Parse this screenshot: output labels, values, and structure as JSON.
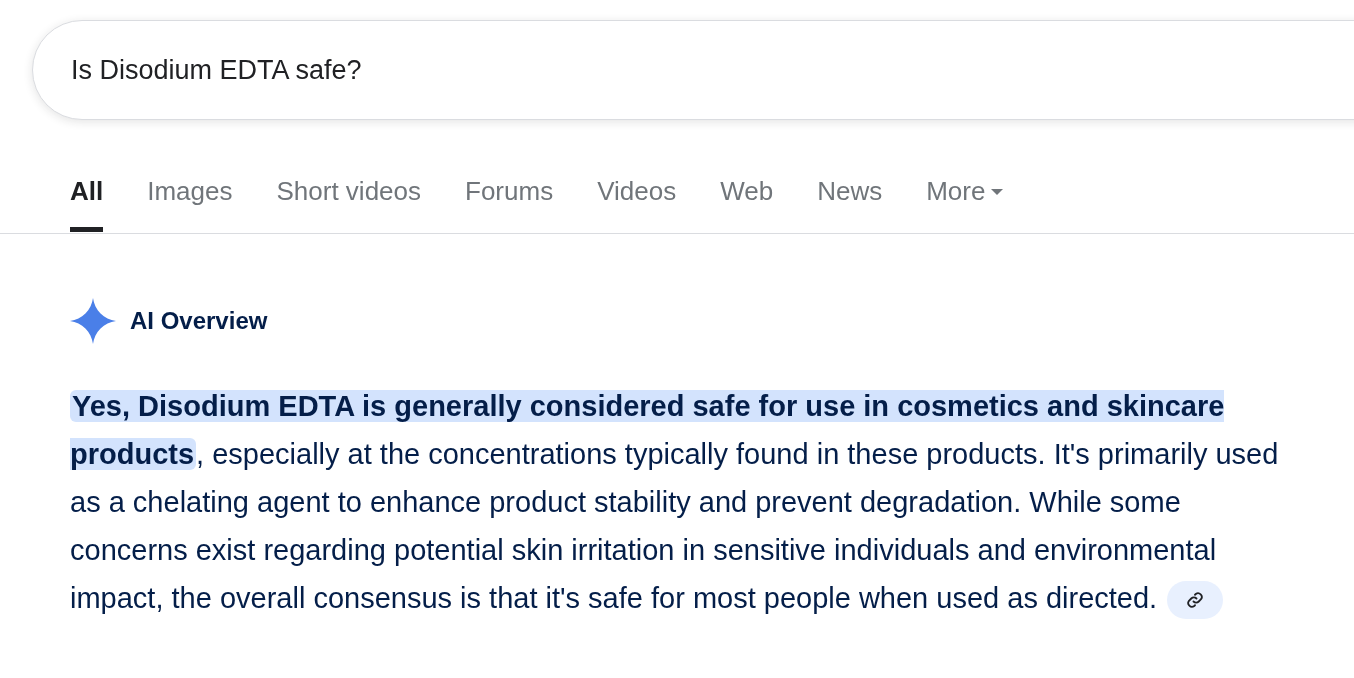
{
  "search": {
    "value": "Is Disodium EDTA safe?"
  },
  "tabs": [
    {
      "label": "All",
      "selected": true
    },
    {
      "label": "Images",
      "selected": false
    },
    {
      "label": "Short videos",
      "selected": false
    },
    {
      "label": "Forums",
      "selected": false
    },
    {
      "label": "Videos",
      "selected": false
    },
    {
      "label": "Web",
      "selected": false
    },
    {
      "label": "News",
      "selected": false
    },
    {
      "label": "More",
      "selected": false,
      "kind": "menu"
    }
  ],
  "ai_overview": {
    "title": "AI Overview",
    "answer": "**Yes, Disodium EDTA is generally considered safe for use in cosmetics and skincare products**, especially at the concentrations typically found in these products. It's primarily used as a chelating agent to enhance product stability and prevent degradation. While some concerns exist regarding potential skin irritation in sensitive individuals and environmental impact, the overall consensus is that it's safe for most people when used as directed."
  }
}
